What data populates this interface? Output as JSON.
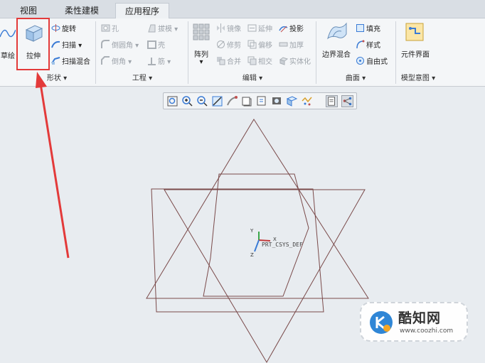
{
  "tabs": [
    {
      "label": "视图"
    },
    {
      "label": "柔性建模"
    },
    {
      "label": "应用程序"
    }
  ],
  "ribbon": {
    "sketch_label": "草绘",
    "extrude_label": "拉伸",
    "revolve_label": "旋转",
    "sweep_label": "扫描",
    "swept_blend_label": "扫描混合",
    "hole_label": "孔",
    "round_label": "倒圆角",
    "chamfer_label": "倒角",
    "draft_label": "拔模",
    "shell_label": "壳",
    "rib_label": "筋",
    "pattern_label": "阵列",
    "mirror_label": "镜像",
    "trim_label": "修剪",
    "merge_label": "合并",
    "extend_label": "延伸",
    "offset_label": "偏移",
    "intersect_label": "相交",
    "project_label": "投影",
    "thicken_label": "加厚",
    "solidify_label": "实体化",
    "boundary_blend_label": "边界混合",
    "fill_label": "填充",
    "style_label": "样式",
    "freestyle_label": "自由式",
    "component_interface_label": "元件界面",
    "groups": {
      "shapes": "形状 ▾",
      "engineering": "工程 ▾",
      "editing": "编辑 ▾",
      "surfaces": "曲面 ▾",
      "model_intent": "模型意图 ▾"
    }
  },
  "graphics": {
    "csys_label": "PRT_CSYS_DEF",
    "axis_x": "X",
    "axis_y": "Y",
    "axis_z": "Z"
  },
  "watermark": {
    "title": "酷知网",
    "url": "www.coozhi.com"
  },
  "colors": {
    "highlight": "#e33a3a",
    "sketch_lines": "#7a4a4a",
    "accent_blue": "#3a7bd5"
  }
}
